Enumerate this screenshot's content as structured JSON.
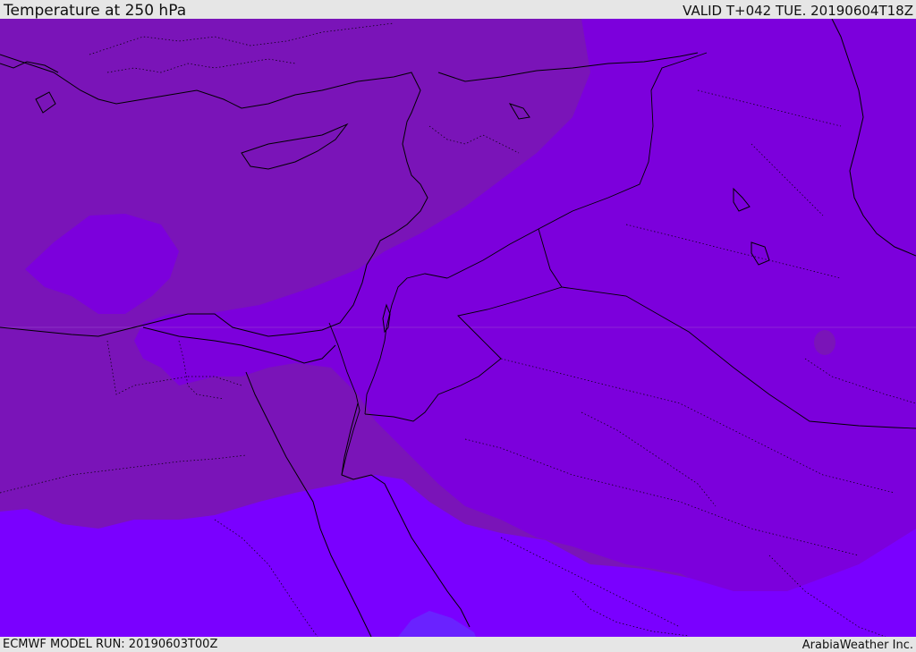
{
  "header": {
    "title": "Temperature at 250 hPa",
    "valid": "VALID T+042 TUE. 20190604T18Z"
  },
  "footer": {
    "model_run": "ECMWF MODEL RUN: 20190603T00Z",
    "credit": "ArabiaWeather Inc."
  },
  "map": {
    "variable": "temperature",
    "level": "250 hPa",
    "colors": {
      "north_band": "#7a14b8",
      "middle_band": "#7c00dc",
      "south_band": "#7a00ff",
      "cold_spot": "#6a22ff",
      "coastline": "#000000",
      "borders": "#000000"
    }
  }
}
